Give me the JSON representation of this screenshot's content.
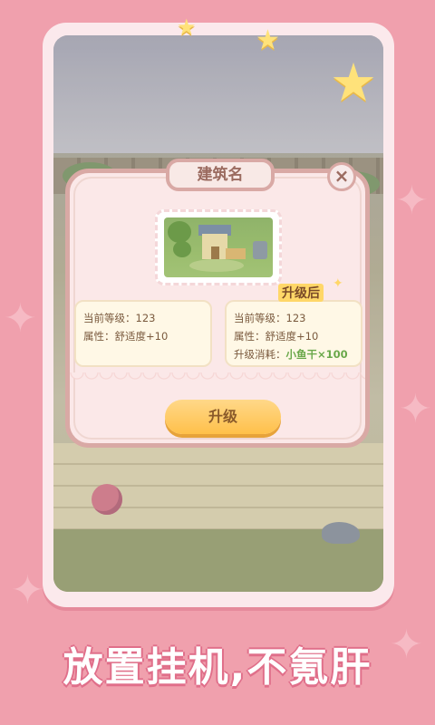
{
  "dialog": {
    "title": "建筑名",
    "close_label": "×",
    "building_image": "building-illustration",
    "current": {
      "level_label": "当前等级：",
      "level_value": "123",
      "attr_label": "属性：",
      "attr_value": "舒适度+10"
    },
    "after": {
      "badge": "升级后",
      "level_label": "当前等级：",
      "level_value": "123",
      "attr_label": "属性：",
      "attr_value": "舒适度+10",
      "cost_label": "升级消耗：",
      "cost_value": "小鱼干×100"
    },
    "upgrade_button": "升级"
  },
  "slogan": "放置挂机,不氪肝",
  "colors": {
    "background": "#f0a0ad",
    "frame": "#fbe9ec",
    "dialog_border": "#d9a9a5",
    "button": "#ffc04a",
    "cost_text": "#69a84a",
    "slogan_outline": "#e06f8a"
  },
  "icons": [
    "star-icon",
    "close-icon",
    "sparkle-icon"
  ]
}
